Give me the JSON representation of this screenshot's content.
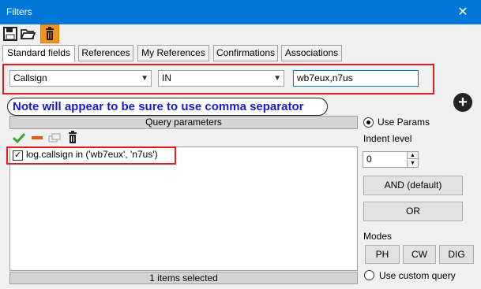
{
  "window": {
    "title": "Filters",
    "close_glyph": "✕"
  },
  "toolbar": {
    "save_icon": "save-icon",
    "open_icon": "folder-open-icon",
    "delete_icon": "trash-icon"
  },
  "tabs": [
    {
      "label": "Standard fields",
      "active": true
    },
    {
      "label": "References",
      "active": false
    },
    {
      "label": "My References",
      "active": false
    },
    {
      "label": "Confirmations",
      "active": false
    },
    {
      "label": "Associations",
      "active": false
    }
  ],
  "filter": {
    "field": "Callsign",
    "operator": "IN",
    "value": "wb7eux,n7us"
  },
  "note": "Note will appear to be sure to use comma separator",
  "add_button_glyph": "+",
  "query": {
    "header": "Query parameters",
    "rows": [
      {
        "checked": true,
        "text": "log.callsign in ('wb7eux', 'n7us')"
      }
    ],
    "footer": "1 items selected"
  },
  "side": {
    "use_params_label": "Use Params",
    "indent_label": "Indent level",
    "indent_value": "0",
    "and_label": "AND (default)",
    "or_label": "OR",
    "modes_label": "Modes",
    "modes": [
      "PH",
      "CW",
      "DIG"
    ],
    "custom_query_label": "Use custom query"
  },
  "colors": {
    "titlebar": "#0078d7",
    "note_text": "#1a1acc",
    "highlight_border": "#e02020",
    "delete_bg": "#f7941d"
  }
}
